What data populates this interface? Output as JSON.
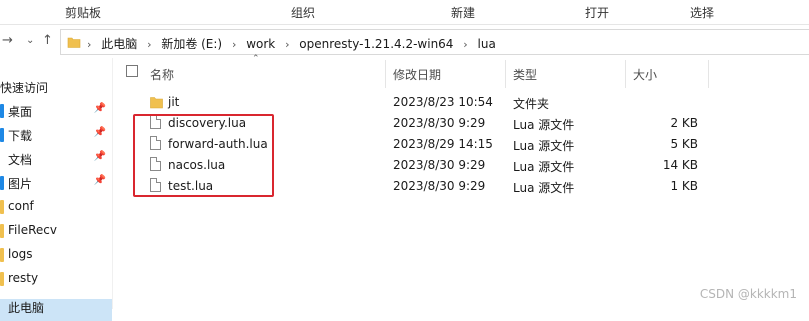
{
  "ribbon": {
    "groups": [
      "剪贴板",
      "组织",
      "新建",
      "打开",
      "选择"
    ]
  },
  "nav": {
    "back_icon": "←",
    "forward_icon": "→",
    "dropdown_icon": "⌄",
    "up_icon": "↑",
    "breadcrumb": [
      "此电脑",
      "新加卷 (E:)",
      "work",
      "openresty-1.21.4.2-win64",
      "lua"
    ],
    "separator": "›"
  },
  "sidebar": {
    "items": [
      {
        "label": "快速访问",
        "pinned": false
      },
      {
        "label": "桌面",
        "pinned": true,
        "edge_color": "#1e88e5"
      },
      {
        "label": "下载",
        "pinned": true,
        "edge_color": "#1e88e5"
      },
      {
        "label": "文档",
        "pinned": true
      },
      {
        "label": "图片",
        "pinned": true,
        "edge_color": "#1e88e5"
      },
      {
        "label": "conf",
        "pinned": false,
        "edge_color": "#f0c04f"
      },
      {
        "label": "FileRecv",
        "pinned": false,
        "edge_color": "#f0c04f"
      },
      {
        "label": "logs",
        "pinned": false,
        "edge_color": "#f0c04f"
      },
      {
        "label": "resty",
        "pinned": false,
        "edge_color": "#f0c04f"
      },
      {
        "label": "此电脑",
        "pinned": false
      }
    ],
    "pin_icon": "📌"
  },
  "columns": {
    "name": "名称",
    "modified": "修改日期",
    "type": "类型",
    "size": "大小"
  },
  "files": [
    {
      "name": "jit",
      "modified": "2023/8/23 10:54",
      "type": "文件夹",
      "size": "",
      "kind": "folder"
    },
    {
      "name": "discovery.lua",
      "modified": "2023/8/30 9:29",
      "type": "Lua 源文件",
      "size": "2 KB",
      "kind": "file"
    },
    {
      "name": "forward-auth.lua",
      "modified": "2023/8/29 14:15",
      "type": "Lua 源文件",
      "size": "5 KB",
      "kind": "file"
    },
    {
      "name": "nacos.lua",
      "modified": "2023/8/30 9:29",
      "type": "Lua 源文件",
      "size": "14 KB",
      "kind": "file"
    },
    {
      "name": "test.lua",
      "modified": "2023/8/30 9:29",
      "type": "Lua 源文件",
      "size": "1 KB",
      "kind": "file"
    }
  ],
  "watermark": "CSDN @kkkkm1",
  "colors": {
    "highlight": "#d9262f",
    "folder": "#f0c04f"
  }
}
